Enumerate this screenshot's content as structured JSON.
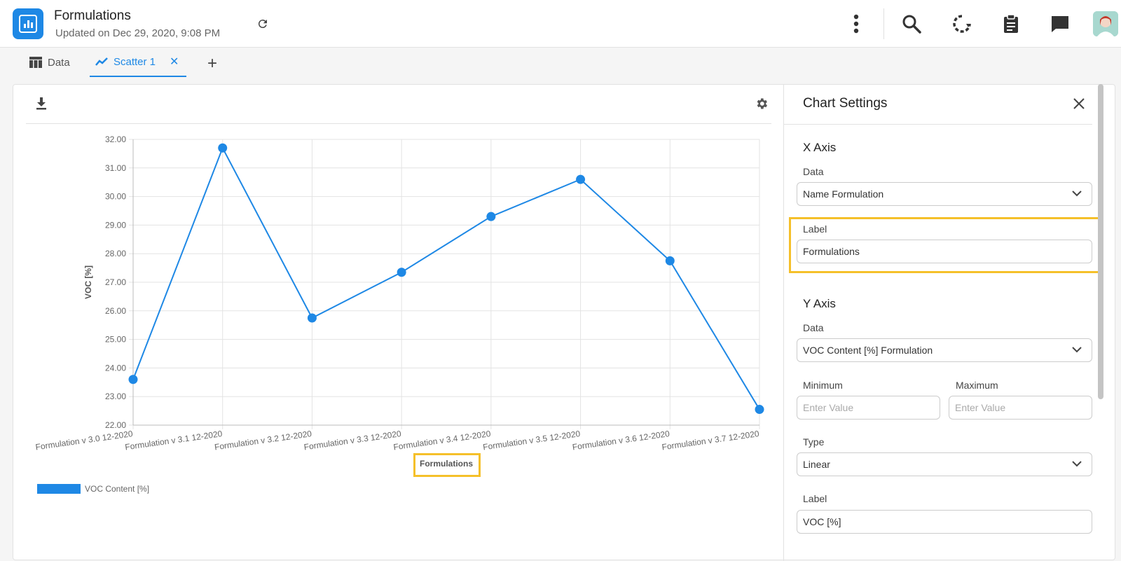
{
  "header": {
    "title": "Formulations",
    "subtitle": "Updated on Dec 29, 2020, 9:08 PM"
  },
  "tabs": [
    {
      "label": "Data"
    },
    {
      "label": "Scatter 1"
    }
  ],
  "colors": {
    "accent": "#1e88e5",
    "highlight": "#f5c02a"
  },
  "settings": {
    "title": "Chart Settings",
    "x_axis": {
      "section": "X Axis",
      "data_label": "Data",
      "data_value": "Name Formulation",
      "label_label": "Label",
      "label_value": "Formulations"
    },
    "y_axis": {
      "section": "Y Axis",
      "data_label": "Data",
      "data_value": "VOC Content [%] Formulation",
      "min_label": "Minimum",
      "min_placeholder": "Enter Value",
      "max_label": "Maximum",
      "max_placeholder": "Enter Value",
      "type_label": "Type",
      "type_value": "Linear",
      "label_label": "Label",
      "label_value": "VOC [%]"
    }
  },
  "chart_data": {
    "type": "line",
    "categories": [
      "Formulation v 3.0 12-2020",
      "Formulation v 3.1 12-2020",
      "Formulation v 3.2 12-2020",
      "Formulation v 3.3 12-2020",
      "Formulation v 3.4 12-2020",
      "Formulation v 3.5 12-2020",
      "Formulation v 3.6 12-2020",
      "Formulation v 3.7 12-2020"
    ],
    "series": [
      {
        "name": "VOC Content [%]",
        "values": [
          23.6,
          31.7,
          25.75,
          27.35,
          29.3,
          30.6,
          27.75,
          22.55
        ]
      }
    ],
    "xlabel": "Formulations",
    "ylabel": "VOC [%]",
    "ylim": [
      22,
      32
    ],
    "yticks": [
      "22.00",
      "23.00",
      "24.00",
      "25.00",
      "26.00",
      "27.00",
      "28.00",
      "29.00",
      "30.00",
      "31.00",
      "32.00"
    ],
    "grid": true,
    "legend": "bottom-left"
  }
}
